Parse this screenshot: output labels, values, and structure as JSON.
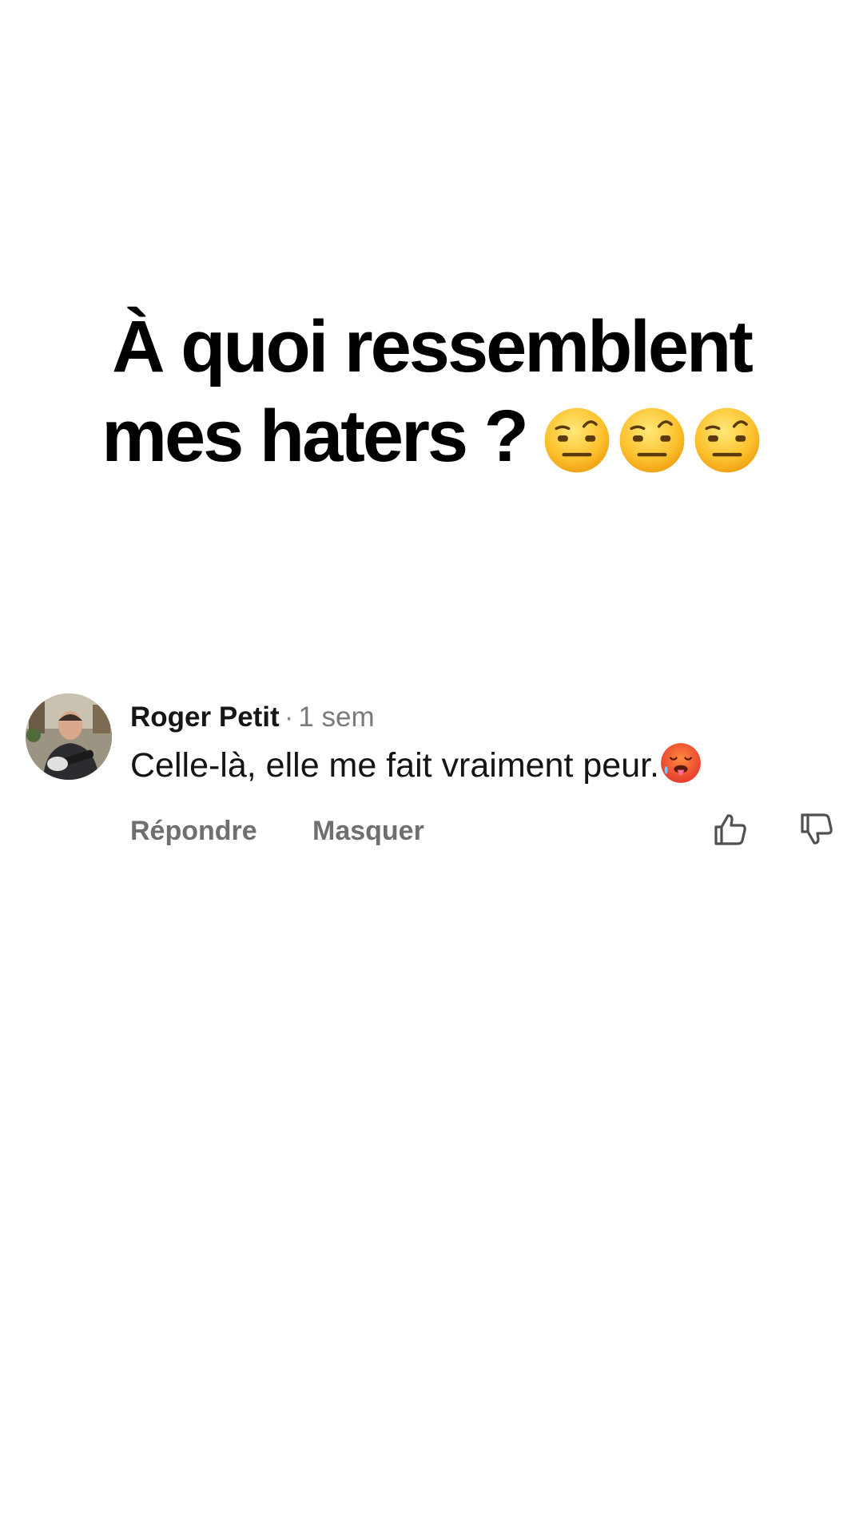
{
  "post": {
    "headline_line1": "À quoi ressemblent",
    "headline_line2": "mes haters ?",
    "headline_emoji": "raised-eyebrow-face-icon",
    "headline_emoji_count": 3
  },
  "comment": {
    "author": "Roger Petit",
    "separator": "·",
    "time": "1 sem",
    "text": "Celle-là,  elle me fait vraiment peur.",
    "text_emoji": "hot-face-icon",
    "actions": {
      "reply_label": "Répondre",
      "hide_label": "Masquer"
    },
    "like_icon": "thumbs-up-icon",
    "dislike_icon": "thumbs-down-icon"
  },
  "colors": {
    "background": "#ffffff",
    "headline": "#000000",
    "action_text": "#6f6f6f",
    "secondary_text": "#7a7a7a"
  }
}
